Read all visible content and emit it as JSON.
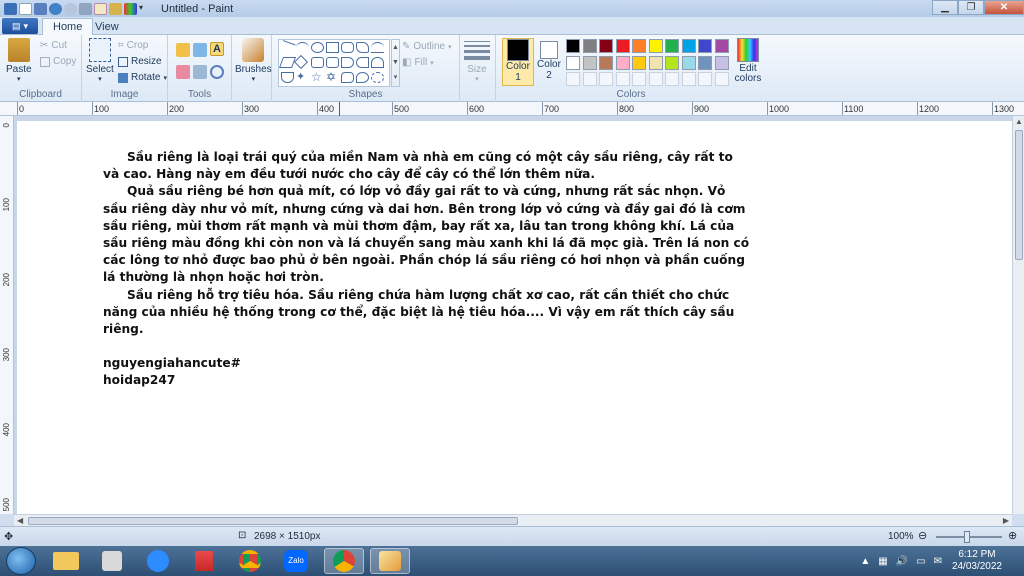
{
  "window": {
    "title": "Untitled - Paint"
  },
  "tabs": [
    {
      "label": "Home"
    },
    {
      "label": "View"
    }
  ],
  "ribbon": {
    "clipboard": {
      "paste": "Paste",
      "cut": "Cut",
      "copy": "Copy",
      "group": "Clipboard"
    },
    "image": {
      "select": "Select",
      "crop": "Crop",
      "resize": "Resize",
      "rotate": "Rotate",
      "group": "Image"
    },
    "tools": {
      "group": "Tools"
    },
    "brushes": {
      "label": "Brushes"
    },
    "shapes": {
      "outline": "Outline",
      "fill": "Fill",
      "group": "Shapes"
    },
    "size": {
      "label": "Size"
    },
    "colors": {
      "color1": "Color 1",
      "color2": "Color 2",
      "edit": "Edit colors",
      "group": "Colors",
      "color1_value": "#000000",
      "color2_value": "#ffffff",
      "palette_row1": [
        "#000000",
        "#7f7f7f",
        "#880015",
        "#ed1c24",
        "#ff7f27",
        "#fff200",
        "#22b14c",
        "#00a2e8",
        "#3f48cc",
        "#a349a4"
      ],
      "palette_row2": [
        "#ffffff",
        "#c3c3c3",
        "#b97a57",
        "#ffaec9",
        "#ffc90e",
        "#efe4b0",
        "#b5e61d",
        "#99d9ea",
        "#7092be",
        "#c8bfe7"
      ]
    }
  },
  "ruler": {
    "h_ticks": [
      "0",
      "100",
      "200",
      "300",
      "400",
      "500",
      "600",
      "700",
      "800",
      "900",
      "1000",
      "1100",
      "1200",
      "1300"
    ],
    "v_ticks": [
      "0",
      "100",
      "200",
      "300",
      "400",
      "500"
    ]
  },
  "document": {
    "paragraphs": [
      "Sầu riêng là loại trái quý của miền Nam và nhà em cũng có một cây sầu riêng, cây rất to và cao.  Hàng này em đều tưới nước cho cây để cây có thể lớn thêm nữa.",
      "Quả sầu riêng bé hơn quả mít, có lớp vỏ đầy gai rất to và cứng, nhưng rất sắc nhọn. Vỏ sầu riêng dày như vỏ mít, nhưng cứng và dai hơn. Bên trong lớp vỏ cứng và đầy gai đó là cơm sầu riêng, mùi thơm rất mạnh và mùi thơm đậm, bay rất xa, lâu tan trong không khí. Lá của sầu riêng màu đồng khi còn non và lá chuyển sang màu xanh khi lá đã mọc già. Trên lá non có các lông tơ nhỏ được bao phủ ở bên ngoài. Phần chóp lá sầu riêng có hơi nhọn và phần cuống lá thường là nhọn hoặc hơi tròn.",
      "Sầu riêng hỗ trợ tiêu hóa. Sầu riêng chứa hàm lượng chất xơ cao, rất cần thiết cho chức năng của nhiều hệ thống trong cơ thể, đặc biệt là hệ tiêu hóa.... Vì vậy em rất thích cây sầu riêng."
    ],
    "signature_line1": "nguyengiahancute#",
    "signature_line2": "hoidap247"
  },
  "status": {
    "dimensions": "2698 × 1510px",
    "zoom": "100%"
  },
  "taskbar": {
    "time": "6:12 PM",
    "date": "24/03/2022"
  }
}
